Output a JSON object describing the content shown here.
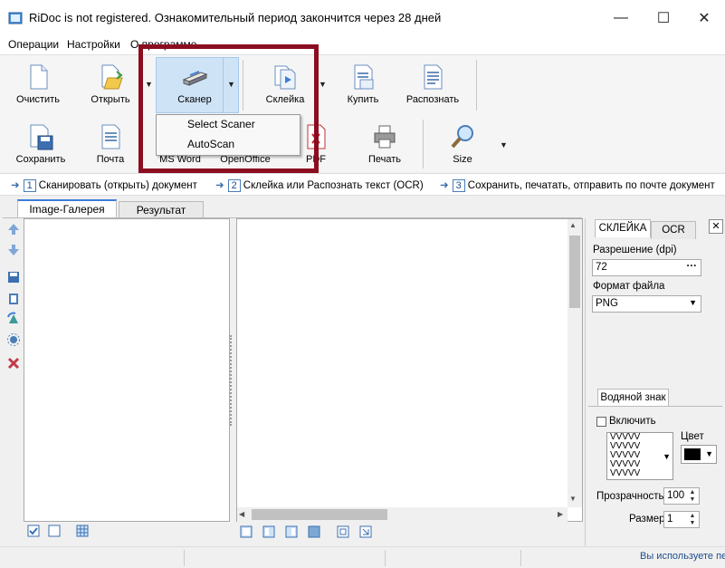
{
  "window": {
    "title": "RiDoc is not registered. Ознакомительный период закончится через 28 дней"
  },
  "menu": [
    "Операции",
    "Настройки",
    "О программе"
  ],
  "toolbar1": {
    "clear": "Очистить",
    "open": "Открыть",
    "scanner": "Сканер",
    "glue": "Склейка",
    "buy": "Купить",
    "recognize": "Распознать"
  },
  "toolbar2": {
    "save": "Сохранить",
    "mail": "Почта",
    "msword": "MS Word",
    "openoffice": "OpenOffice",
    "pdf": "PDF",
    "print": "Печать",
    "size": "Size"
  },
  "scanner_menu": [
    "Select Scaner",
    "AutoScan"
  ],
  "steps": [
    {
      "num": "1",
      "text": "Сканировать (открыть) документ"
    },
    {
      "num": "2",
      "text": "Склейка или Распознать текст (OCR)"
    },
    {
      "num": "3",
      "text": "Сохранить, печатать, отправить по почте документ"
    }
  ],
  "tabs": {
    "gallery": "Image-Галерея",
    "result": "Результат"
  },
  "right_panel": {
    "tab_active": "СКЛЕЙКА",
    "tab_ocr": "OCR",
    "close": "✕",
    "resolution_label": "Разрешение (dpi)",
    "resolution_value": "72",
    "ellipsis": "···",
    "format_label": "Формат файла",
    "format_value": "PNG",
    "watermark_tab": "Водяной знак",
    "enable_label": "Включить",
    "color_label": "Цвет",
    "watermark_pattern": "VVVVV",
    "transparency_label": "Прозрачность",
    "transparency_value": "100",
    "size_label": "Размер",
    "size_value": "1"
  },
  "status": {
    "text": "Вы используете пе"
  }
}
